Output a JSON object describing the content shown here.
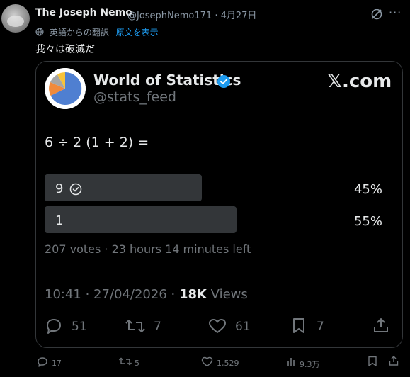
{
  "header": {
    "name": "The Joseph Nemo",
    "handle_line": "@JosephNemo171 · 4月27日",
    "translation_note": "英語からの翻訳",
    "show_original": "原文を表示",
    "text": "我々は破滅だ"
  },
  "card": {
    "account_name": "World of Statistics",
    "account_handle": "@stats_feed",
    "brand": "𝕏.com",
    "question": "6 ÷ 2 (1 + 2) =",
    "options": [
      {
        "label": "9",
        "percent_text": "45%",
        "share": 0.45,
        "selected": true
      },
      {
        "label": "1",
        "percent_text": "55%",
        "share": 0.55,
        "selected": false
      }
    ],
    "votes_text": "207 votes · 23 hours 14 minutes left",
    "timestamp_text": "10:41 · 27/04/2026 · ",
    "views_number": "18K",
    "views_label": " Views",
    "actions": {
      "replies": "51",
      "reposts": "7",
      "likes": "61",
      "bookmarks": "7"
    }
  },
  "footer_actions": {
    "replies": "17",
    "reposts": "5",
    "likes": "1,529",
    "views": "9.3万"
  },
  "colors": {
    "background": "#000000",
    "text": "#e7e9ea",
    "muted": "#71767b",
    "link": "#1d9bf0",
    "bar": "#333639"
  }
}
